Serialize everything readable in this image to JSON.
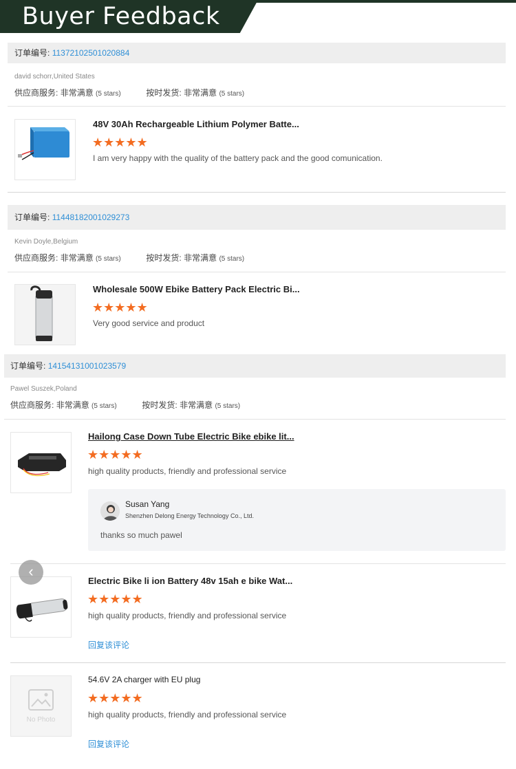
{
  "banner": {
    "title": "Buyer Feedback"
  },
  "labels": {
    "order_no": "订单编号:",
    "supplier_service": "供应商服务:",
    "on_time": "按时发货:",
    "very_satisfied": "非常满意",
    "five_stars": "(5 stars)",
    "reply_comment": "回复该评论",
    "no_photo": "No Photo"
  },
  "orders": [
    {
      "number": "11372102501020884",
      "buyer": "david schorr,United States",
      "products": [
        {
          "title": "48V 30Ah Rechargeable Lithium Polymer Batte...",
          "rating": 5,
          "stars": "★★★★★",
          "review": "I am very happy with the quality of the battery pack and the good comunication."
        }
      ]
    },
    {
      "number": "11448182001029273",
      "buyer": "Kevin Doyle,Belgium",
      "products": [
        {
          "title": "Wholesale 500W Ebike Battery Pack Electric Bi...",
          "rating": 5,
          "stars": "★★★★★",
          "review": "Very good service and product"
        }
      ]
    },
    {
      "number": "14154131001023579",
      "buyer": "Pawel Suszek,Poland",
      "products": [
        {
          "title": "Hailong Case Down Tube Electric Bike ebike lit...",
          "rating": 5,
          "stars": "★★★★★",
          "review": "high quality products, friendly and professional service",
          "supplier_reply": {
            "name": "Susan Yang",
            "company": "Shenzhen Delong Energy Technology Co., Ltd.",
            "message": "thanks so much pawel"
          }
        },
        {
          "title": "Electric Bike li ion Battery 48v 15ah e bike Wat...",
          "rating": 5,
          "stars": "★★★★★",
          "review": "high quality products, friendly and professional service"
        },
        {
          "title": "54.6V 2A charger with EU plug",
          "rating": 5,
          "stars": "★★★★★",
          "review": "high quality products, friendly and professional service"
        }
      ]
    }
  ],
  "colors": {
    "banner": "#1f3426",
    "accent_star": "#f36c21",
    "link": "#2f8fd6"
  },
  "icons": {
    "carousel_prev": "chevron-left-icon"
  }
}
